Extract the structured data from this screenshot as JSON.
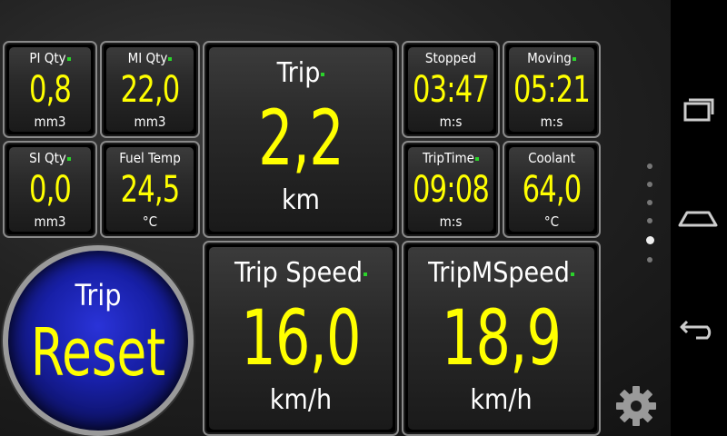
{
  "gauges_small": [
    {
      "label": "PI Qty",
      "value": "0,8",
      "unit": "mm3"
    },
    {
      "label": "MI Qty",
      "value": "22,0",
      "unit": "mm3"
    },
    {
      "label": "SI Qty",
      "value": "0,0",
      "unit": "mm3"
    },
    {
      "label": "Fuel Temp",
      "value": "24,5",
      "unit": "°C"
    },
    {
      "label": "Stopped",
      "value": "03:47",
      "unit": "m:s"
    },
    {
      "label": "Moving",
      "value": "05:21",
      "unit": "m:s"
    },
    {
      "label": "TripTime",
      "value": "09:08",
      "unit": "m:s"
    },
    {
      "label": "Coolant",
      "value": "64,0",
      "unit": "°C"
    }
  ],
  "gauges_large": [
    {
      "label": "Trip",
      "value": "2,2",
      "unit": "km"
    },
    {
      "label": "Trip Speed",
      "value": "16,0",
      "unit": "km/h"
    },
    {
      "label": "TripMSpeed",
      "value": "18,9",
      "unit": "km/h"
    }
  ],
  "reset_button": {
    "top": "Trip",
    "main": "Reset"
  },
  "colors": {
    "value": "#ffff00",
    "label": "#ffffff",
    "reset_bg": "#1820a8",
    "indicator": "#2bd42b"
  },
  "icons": {
    "settings": "gear-icon",
    "recents": "recent-apps-icon",
    "home": "home-icon",
    "back": "back-icon"
  },
  "page_indicator": {
    "count": 6,
    "active": 5
  }
}
